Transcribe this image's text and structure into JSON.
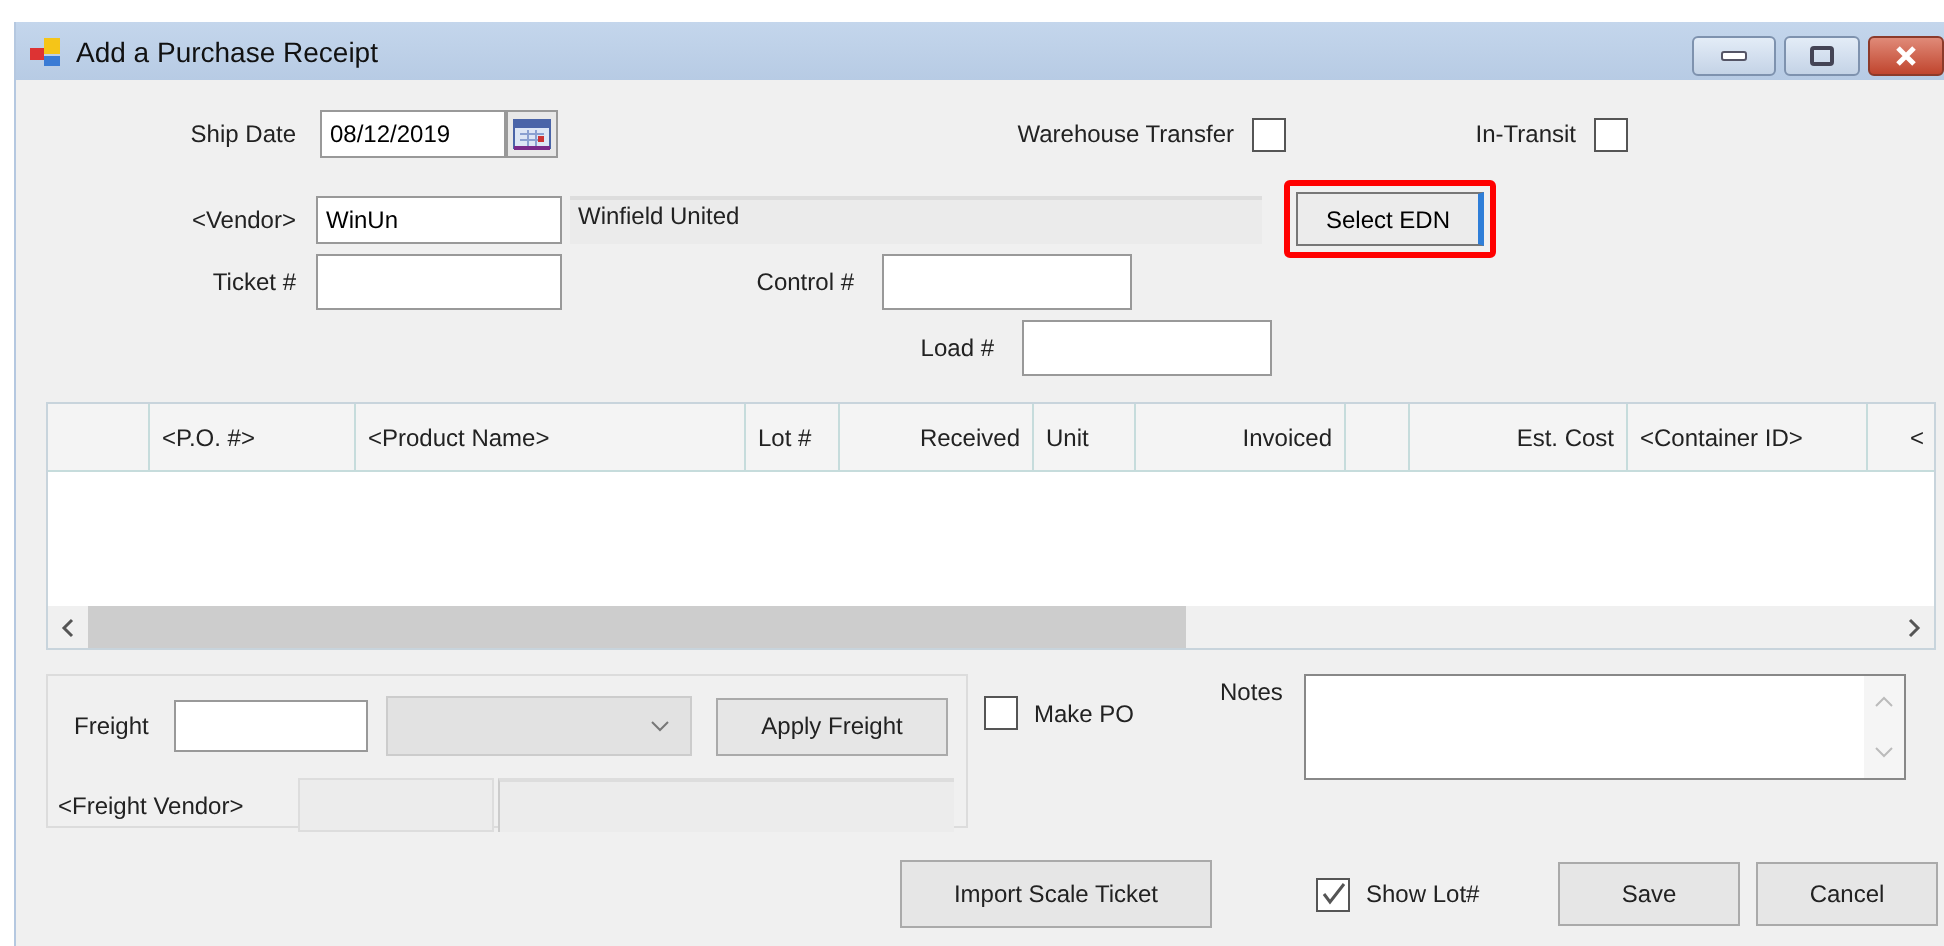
{
  "window": {
    "title": "Add a Purchase Receipt"
  },
  "ship_date": {
    "label": "Ship Date",
    "value": "08/12/2019"
  },
  "warehouse_transfer": {
    "label": "Warehouse Transfer",
    "checked": false
  },
  "in_transit": {
    "label": "In-Transit",
    "checked": false
  },
  "vendor": {
    "label": "<Vendor>",
    "value": "WinUn",
    "name": "Winfield United"
  },
  "select_edn": {
    "label": "Select EDN",
    "highlighted": true
  },
  "ticket": {
    "label": "Ticket #"
  },
  "control": {
    "label": "Control #"
  },
  "load": {
    "label": "Load #"
  },
  "table": {
    "columns": [
      {},
      {
        "label": "<P.O. #>"
      },
      {
        "label": "<Product Name>"
      },
      {
        "label": "Lot #"
      },
      {
        "label": "Received"
      },
      {
        "label": "Unit"
      },
      {
        "label": "Invoiced"
      },
      {},
      {
        "label": "Est. Cost"
      },
      {
        "label": "<Container ID>"
      },
      {
        "label": "<"
      }
    ]
  },
  "freight": {
    "label": "Freight",
    "button": "Apply Freight",
    "vendor_label": "<Freight Vendor>"
  },
  "make_po": {
    "label": "Make PO",
    "checked": false
  },
  "notes": {
    "label": "Notes"
  },
  "import_button": "Import Scale Ticket",
  "show_lot": {
    "label": "Show Lot#",
    "checked": true
  },
  "buttons": [
    "Save",
    "Cancel"
  ]
}
